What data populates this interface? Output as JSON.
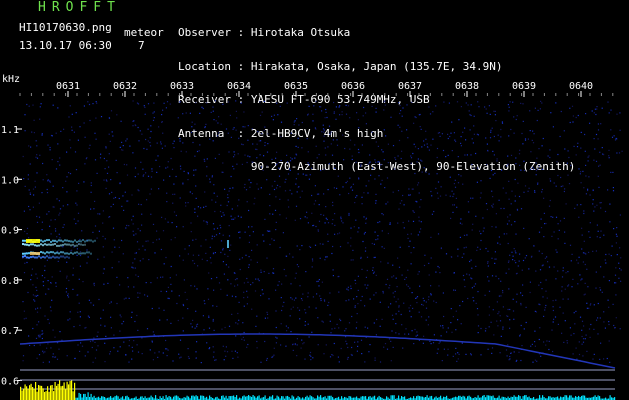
{
  "header": {
    "logo": "HROFFT",
    "file_name": "HI10170630.png",
    "meteor_label": "meteor",
    "date_time": "13.10.17 06:30",
    "meteor_count": "7"
  },
  "station": [
    {
      "label": "Observer",
      "value": "Hirotaka Otsuka"
    },
    {
      "label": "Location",
      "value": "Hirakata, Osaka, Japan (135.7E, 34.9N)"
    },
    {
      "label": "Receiver",
      "value": "YAESU FT-690 53.749MHz, USB"
    },
    {
      "label": "Antenna ",
      "value": "2el-HB9CV, 4m's high"
    },
    {
      "label": "        ",
      "value": "90-270-Azimuth (East-West), 90-Elevation (Zenith)"
    }
  ],
  "axes": {
    "y_unit": "kHz",
    "time_ticks": [
      "0631",
      "0632",
      "0633",
      "0634",
      "0635",
      "0636",
      "0637",
      "0638",
      "0639",
      "0640"
    ],
    "freq_ticks": [
      "1.1",
      "1.0",
      "0.9",
      "0.8",
      "0.7",
      "0.6"
    ]
  },
  "colors": {
    "text_green": "#6fe24d",
    "noise_blue": "#1a2f9a",
    "signal_cyan": "#5fd0ff",
    "signal_yellow": "#ffff00",
    "level_cyan": "#00e5ff"
  }
}
